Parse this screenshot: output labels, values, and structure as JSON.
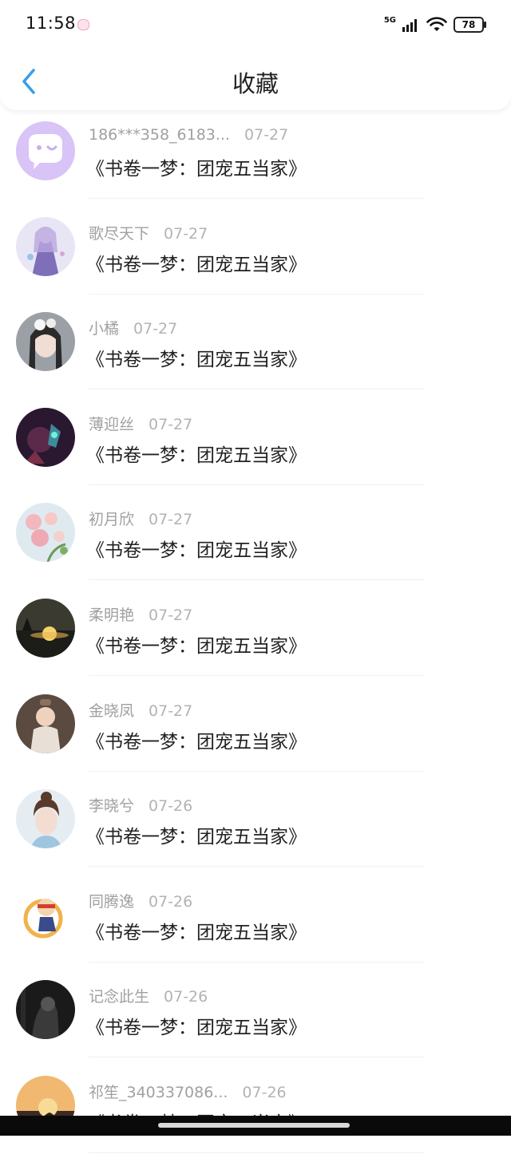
{
  "status_bar": {
    "time": "11:58",
    "network": "5G",
    "battery": "78"
  },
  "header": {
    "title": "收藏"
  },
  "colors": {
    "accent": "#3a9ee8",
    "meta_text": "#a0a0a0",
    "title_text": "#222222"
  },
  "items": [
    {
      "name": "186***358_6183...",
      "date": "07-27",
      "title": "《书卷一梦：团宠五当家》",
      "avatar": "chat-bubble-avatar"
    },
    {
      "name": "歌尽天下",
      "date": "07-27",
      "title": "《书卷一梦：团宠五当家》",
      "avatar": "anime-girl-avatar"
    },
    {
      "name": "小橘",
      "date": "07-27",
      "title": "《书卷一梦：团宠五当家》",
      "avatar": "portrait-avatar"
    },
    {
      "name": "薄迎丝",
      "date": "07-27",
      "title": "《书卷一梦：团宠五当家》",
      "avatar": "game-character-avatar"
    },
    {
      "name": "初月欣",
      "date": "07-27",
      "title": "《书卷一梦：团宠五当家》",
      "avatar": "flowers-avatar"
    },
    {
      "name": "柔明艳",
      "date": "07-27",
      "title": "《书卷一梦：团宠五当家》",
      "avatar": "sunset-avatar"
    },
    {
      "name": "金晓凤",
      "date": "07-27",
      "title": "《书卷一梦：团宠五当家》",
      "avatar": "baby-avatar"
    },
    {
      "name": "李晓兮",
      "date": "07-26",
      "title": "《书卷一梦：团宠五当家》",
      "avatar": "woman-portrait-avatar"
    },
    {
      "name": "同腾逸",
      "date": "07-26",
      "title": "《书卷一梦：团宠五当家》",
      "avatar": "cartoon-avatar"
    },
    {
      "name": "记念此生",
      "date": "07-26",
      "title": "《书卷一梦：团宠五当家》",
      "avatar": "dark-portrait-avatar"
    },
    {
      "name": "祁笙_340337086...",
      "date": "07-26",
      "title": "《书卷一梦：团宠五当家》",
      "avatar": "dusk-avatar"
    }
  ]
}
